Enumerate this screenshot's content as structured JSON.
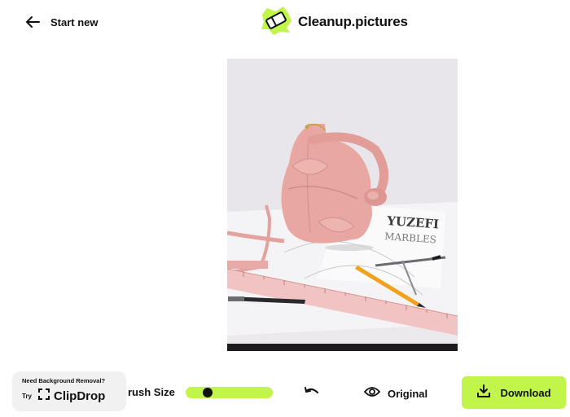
{
  "header": {
    "start_new_label": "Start new",
    "brand_name": "Cleanup.pictures",
    "icons": {
      "back": "arrow-left-icon",
      "logo": "eraser-logo-icon"
    }
  },
  "canvas": {
    "image": "photo-pink-handbag",
    "image_text": [
      "YUZEFI",
      "MARBLES"
    ]
  },
  "promo": {
    "title": "Need Background Removal?",
    "try_label": "Try",
    "brand_name": "ClipDrop",
    "icon": "clipdrop-icon"
  },
  "toolbar": {
    "brush_size_label": "rush Size",
    "brush_size_value": 0.25,
    "undo_icon": "undo-icon",
    "original_label": "Original",
    "original_icon": "eye-icon",
    "download_label": "Download",
    "download_icon": "download-icon"
  },
  "colors": {
    "accent": "#c2f54a",
    "text": "#111111",
    "promo_bg": "#f1f1f1",
    "bag_pink": "#e8a7a3"
  }
}
